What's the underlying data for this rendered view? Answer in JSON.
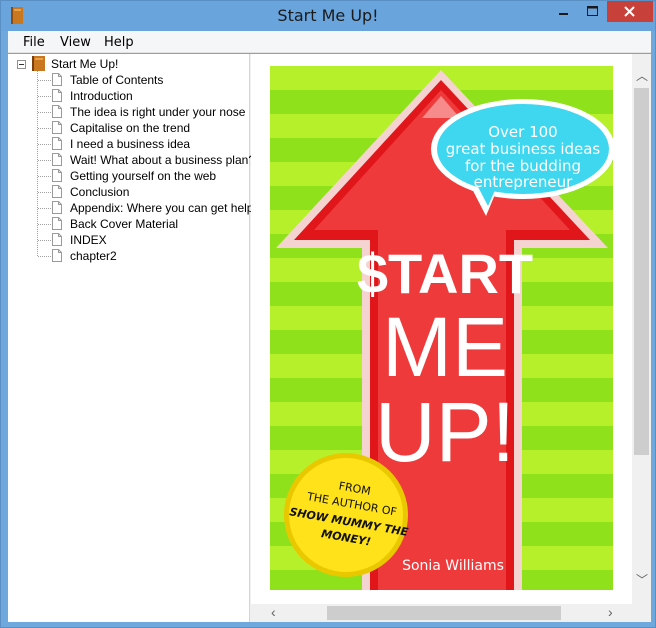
{
  "window": {
    "title": "Start Me Up!",
    "icon": "book-icon",
    "controls": [
      "minimize-icon",
      "maximize-icon",
      "close-icon"
    ],
    "colors": {
      "titlebar": "#6aa4dc",
      "close": "#c7403a"
    }
  },
  "menu": {
    "file": "File",
    "view": "View",
    "help": "Help"
  },
  "tree": {
    "root_label": "Start Me Up!",
    "items": [
      {
        "label": "Table of Contents"
      },
      {
        "label": "Introduction"
      },
      {
        "label": "The idea is right under your nose"
      },
      {
        "label": "Capitalise on the trend"
      },
      {
        "label": "I need a business idea"
      },
      {
        "label": "Wait! What about a business plan?"
      },
      {
        "label": "Getting yourself on the web"
      },
      {
        "label": "Conclusion"
      },
      {
        "label": "Appendix: Where you can get help"
      },
      {
        "label": "Back Cover Material"
      },
      {
        "label": "INDEX"
      },
      {
        "label": "chapter2"
      }
    ]
  },
  "cover": {
    "bubble_line1": "Over 100",
    "bubble_line2": "great business ideas",
    "bubble_line3": "for the budding",
    "bubble_line4": "entrepreneur",
    "title_line1": "$TART",
    "title_line2": "ME",
    "title_line3": "UP!",
    "badge_line1": "FROM",
    "badge_line2": "THE AUTHOR OF",
    "badge_line3": "SHOW MUMMY THE",
    "badge_line4": "MONEY!",
    "author": "Sonia Williams",
    "colors": {
      "stripe_a": "#8fe21b",
      "stripe_b": "#b6f02a",
      "arrow": "#e0161b",
      "bubble": "#3fd6f0",
      "badge": "#ffe21a"
    }
  }
}
